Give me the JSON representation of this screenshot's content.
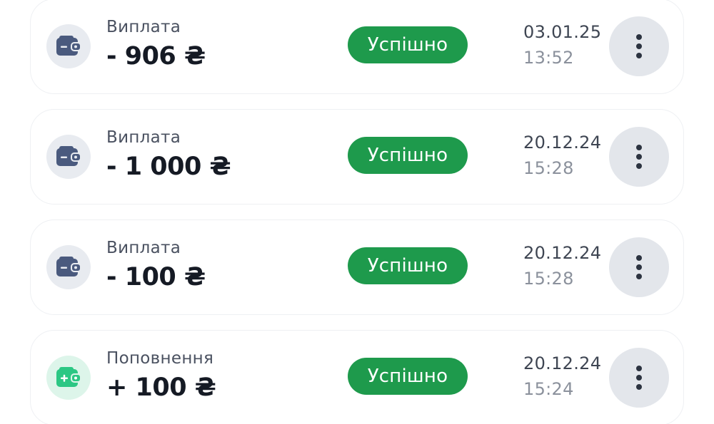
{
  "colors": {
    "success_badge": "#1e9a4c",
    "outgoing_icon": "#4a5a7e",
    "incoming_icon": "#2cc784"
  },
  "transactions": [
    {
      "type": "Виплата",
      "direction": "out",
      "icon": "wallet-minus-icon",
      "amount": "- 906 ₴",
      "status": "Успішно",
      "date": "03.01.25",
      "time": "13:52",
      "menu_icon": "more-vertical-icon"
    },
    {
      "type": "Виплата",
      "direction": "out",
      "icon": "wallet-minus-icon",
      "amount": "- 1 000 ₴",
      "status": "Успішно",
      "date": "20.12.24",
      "time": "15:28",
      "menu_icon": "more-vertical-icon"
    },
    {
      "type": "Виплата",
      "direction": "out",
      "icon": "wallet-minus-icon",
      "amount": "- 100 ₴",
      "status": "Успішно",
      "date": "20.12.24",
      "time": "15:28",
      "menu_icon": "more-vertical-icon"
    },
    {
      "type": "Поповнення",
      "direction": "in",
      "icon": "wallet-plus-icon",
      "amount": "+ 100 ₴",
      "status": "Успішно",
      "date": "20.12.24",
      "time": "15:24",
      "menu_icon": "more-vertical-icon"
    }
  ]
}
